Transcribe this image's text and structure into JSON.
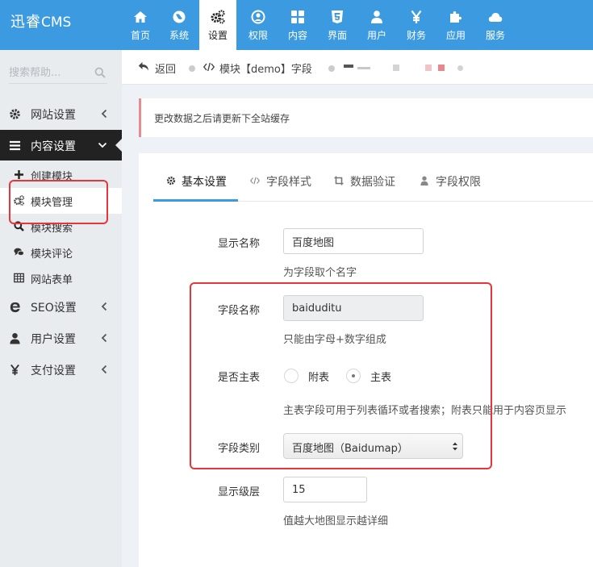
{
  "app": {
    "brand": "迅睿",
    "brand_suffix": "CMS"
  },
  "nav": [
    {
      "label": "首页",
      "icon": "home-icon"
    },
    {
      "label": "系统",
      "icon": "globe-icon"
    },
    {
      "label": "设置",
      "icon": "gears-icon",
      "active": true
    },
    {
      "label": "权限",
      "icon": "user-circle-icon"
    },
    {
      "label": "内容",
      "icon": "grid-icon"
    },
    {
      "label": "界面",
      "icon": "html5-icon"
    },
    {
      "label": "用户",
      "icon": "user-icon"
    },
    {
      "label": "财务",
      "icon": "yen-icon"
    },
    {
      "label": "应用",
      "icon": "puzzle-icon"
    },
    {
      "label": "服务",
      "icon": "cloud-icon"
    }
  ],
  "sidebar": {
    "search_placeholder": "搜索帮助...",
    "items": {
      "site_settings": "网站设置",
      "content_settings": "内容设置",
      "create_module": "创建模块",
      "module_manage": "模块管理",
      "module_search": "模块搜索",
      "module_comment": "模块评论",
      "site_form": "网站表单",
      "seo_settings": "SEO设置",
      "user_settings": "用户设置",
      "pay_settings": "支付设置"
    }
  },
  "breadcrumb": {
    "back": "返回",
    "current": "模块【demo】字段"
  },
  "notice": "更改数据之后请更新下全站缓存",
  "tabs": {
    "basic": "基本设置",
    "style": "字段样式",
    "validate": "数据验证",
    "permission": "字段权限"
  },
  "form": {
    "display_name": {
      "label": "显示名称",
      "value": "百度地图",
      "help": "为字段取个名字"
    },
    "field_name": {
      "label": "字段名称",
      "value": "baiduditu",
      "help": "只能由字母+数字组成"
    },
    "is_main": {
      "label": "是否主表",
      "option_sub": "附表",
      "option_main": "主表",
      "help": "主表字段可用于列表循环或者搜索；附表只能用于内容页显示"
    },
    "field_type": {
      "label": "字段类别",
      "value": "百度地图（Baidumap）"
    },
    "display_level": {
      "label": "显示级层",
      "value": "15",
      "help": "值越大地图显示越详细"
    }
  },
  "colors": {
    "primary": "#3c9be0",
    "highlight": "#e8353c"
  }
}
